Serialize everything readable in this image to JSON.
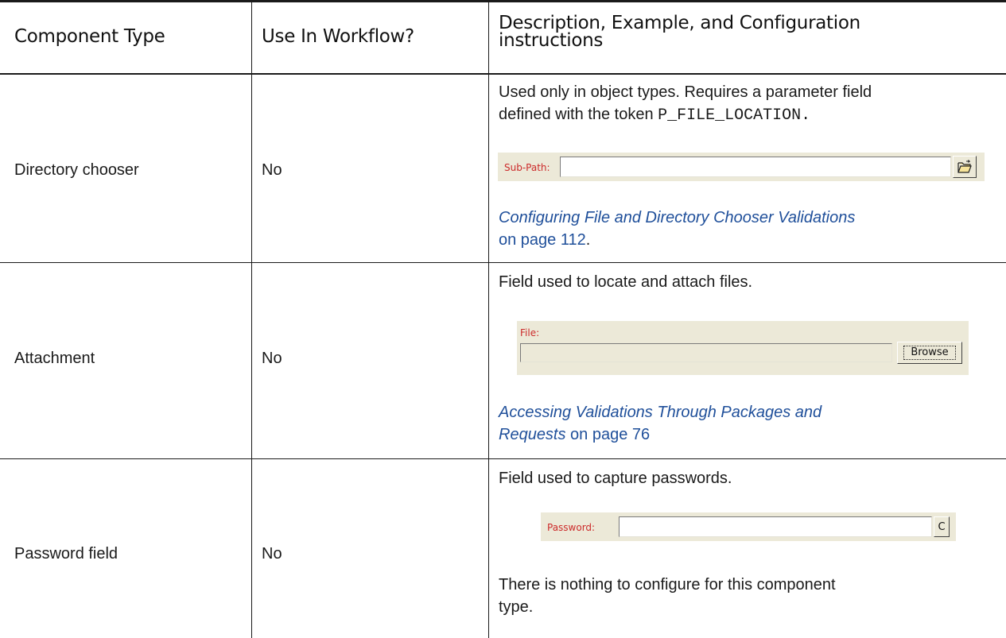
{
  "header": {
    "col1": "Component Type",
    "col2": "Use In Workflow?",
    "col3_line1": "Description, Example, and Configuration",
    "col3_line2": "instructions"
  },
  "rows": [
    {
      "type": "Directory chooser",
      "workflow": "No",
      "desc1_line1": "Used only in object types. Requires a parameter field",
      "desc1_prefix": "defined with the token ",
      "desc1_token": "P_FILE_LOCATION.",
      "widget_label": "Sub-Path:",
      "widget_button_icon": "folder-open-icon",
      "link_line1": "Configuring File and Directory Chooser Validations",
      "link_suffix": "on page 112",
      "link_end": "."
    },
    {
      "type": "Attachment",
      "workflow": "No",
      "desc1": "Field used to locate and attach files.",
      "widget_label": "File:",
      "widget_button": "Browse",
      "link_line1": "Accessing Validations Through Packages and",
      "link_line2_italic": "Requests",
      "link_suffix": " on page 76"
    },
    {
      "type": "Password field",
      "workflow": "No",
      "desc1": "Field used to capture passwords.",
      "widget_label": "Password:",
      "widget_button": "C",
      "desc2_line1": "There is nothing to configure for this component",
      "desc2_line2": "type."
    }
  ]
}
